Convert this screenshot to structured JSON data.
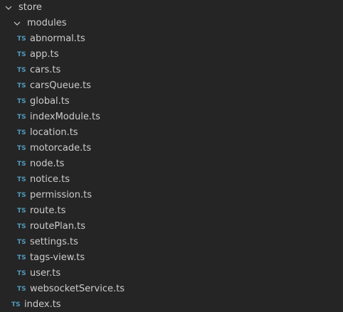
{
  "tree": {
    "root_folder": "store",
    "sub_folder": "modules",
    "file_badge": "TS",
    "module_files": [
      "abnormal.ts",
      "app.ts",
      "cars.ts",
      "carsQueue.ts",
      "global.ts",
      "indexModule.ts",
      "location.ts",
      "motorcade.ts",
      "node.ts",
      "notice.ts",
      "permission.ts",
      "route.ts",
      "routePlan.ts",
      "settings.ts",
      "tags-view.ts",
      "user.ts",
      "websocketService.ts"
    ],
    "root_files": [
      "index.ts"
    ]
  },
  "colors": {
    "background": "#252526",
    "text": "#cccccc",
    "ts_badge": "#519aba"
  },
  "icons": {
    "folder_expanded": "chevron-down-icon",
    "file_type": "typescript-file-icon"
  }
}
